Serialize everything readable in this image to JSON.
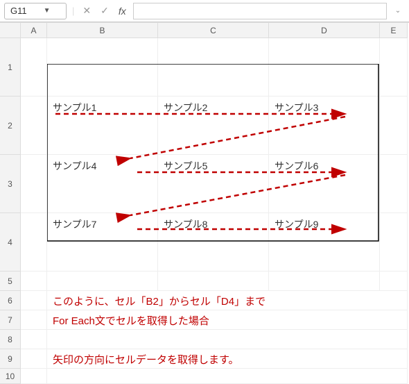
{
  "name_box": {
    "value": "G11"
  },
  "formula_bar": {
    "fx_label": "fx",
    "value": ""
  },
  "columns": [
    "A",
    "B",
    "C",
    "D",
    "E"
  ],
  "rows": [
    "1",
    "2",
    "3",
    "4",
    "5",
    "6",
    "7",
    "8",
    "9",
    "10"
  ],
  "grid": {
    "B2": "サンプル1",
    "C2": "サンプル2",
    "D2": "サンプル3",
    "B3": "サンプル4",
    "C3": "サンプル5",
    "D3": "サンプル6",
    "B4": "サンプル7",
    "C4": "サンプル8",
    "D4": "サンプル9"
  },
  "notes": {
    "line1": "このように、セル「B2」からセル「D4」まで",
    "line2": "For Each文でセルを取得した場合",
    "line3": "矢印の方向にセルデータを取得します。"
  },
  "arrow_color": "#c00000"
}
